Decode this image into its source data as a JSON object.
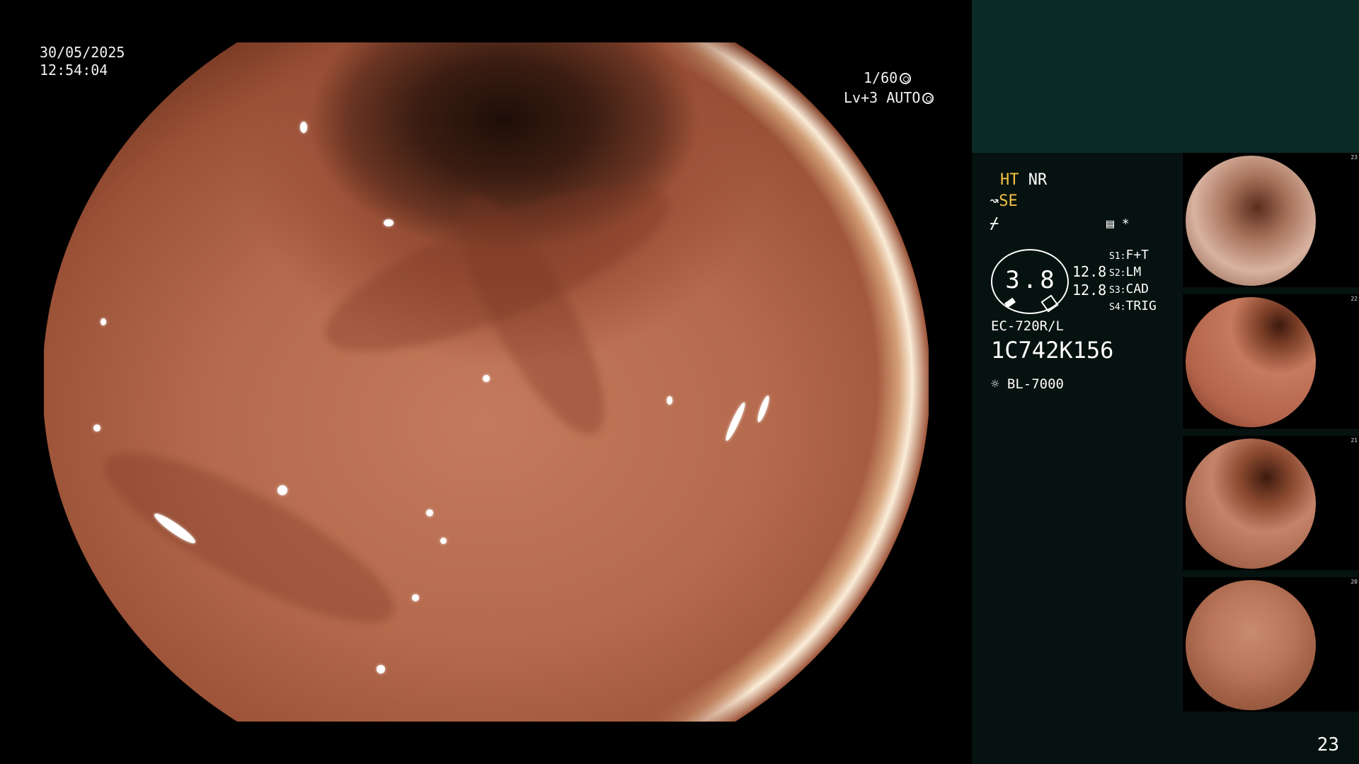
{
  "overlay": {
    "date": "30/05/2025",
    "time": "12:54:04",
    "shutter": "1/60",
    "level": "Lv+3 AUTO"
  },
  "status": {
    "ht": "HT",
    "nr": "NR",
    "se": "SE",
    "zoom": "3.8",
    "value_top": "12.8",
    "value_bottom": "12.8",
    "s1": "F+T",
    "s2": "LM",
    "s3": "CAD",
    "s4": "TRIG",
    "s1_label": "S1:",
    "s2_label": "S2:",
    "s3_label": "S3:",
    "s4_label": "S4:",
    "scope_model": "EC-720R/L",
    "serial": "1C742K156",
    "light_source": "BL-7000",
    "star": "*"
  },
  "thumbnails": [
    {
      "number": "23"
    },
    {
      "number": "22"
    },
    {
      "number": "21"
    },
    {
      "number": "20"
    }
  ],
  "page_number": "23",
  "colors": {
    "side_panel": "#061210",
    "side_header": "#0a2a26",
    "accent_yellow": "#f5c242"
  }
}
